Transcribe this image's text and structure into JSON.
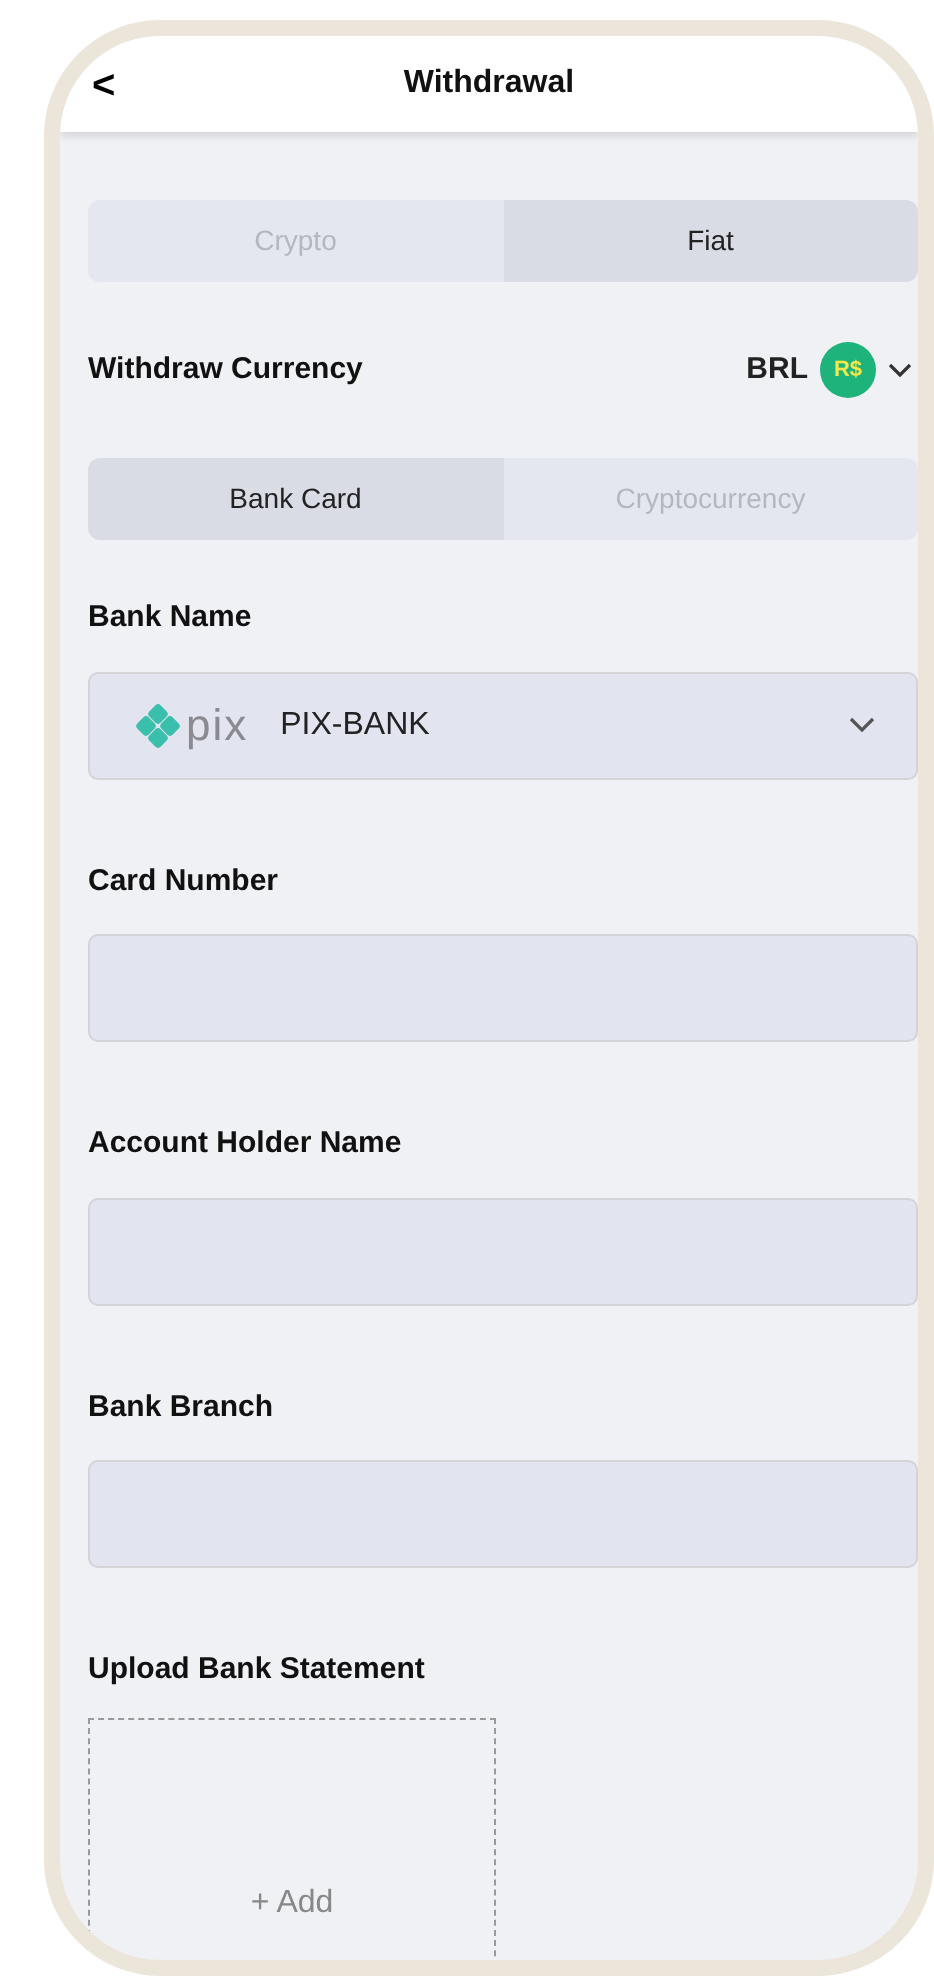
{
  "header": {
    "back": "<",
    "title": "Withdrawal"
  },
  "mode_tabs": [
    {
      "label": "Crypto",
      "selected": false
    },
    {
      "label": "Fiat",
      "selected": true
    }
  ],
  "currency": {
    "label": "Withdraw Currency",
    "code": "BRL",
    "symbol": "R$"
  },
  "method_tabs": [
    {
      "label": "Bank Card",
      "selected": true
    },
    {
      "label": "Cryptocurrency",
      "selected": false
    }
  ],
  "fields": [
    {
      "kind": "select",
      "label": "Bank Name",
      "logo": "pix",
      "value": "PIX-BANK"
    },
    {
      "kind": "input",
      "label": "Card Number"
    },
    {
      "kind": "input",
      "label": "Account Holder Name"
    },
    {
      "kind": "input",
      "label": "Bank Branch"
    },
    {
      "kind": "upload",
      "label": "Upload Bank Statement",
      "button": "+ Add"
    }
  ]
}
